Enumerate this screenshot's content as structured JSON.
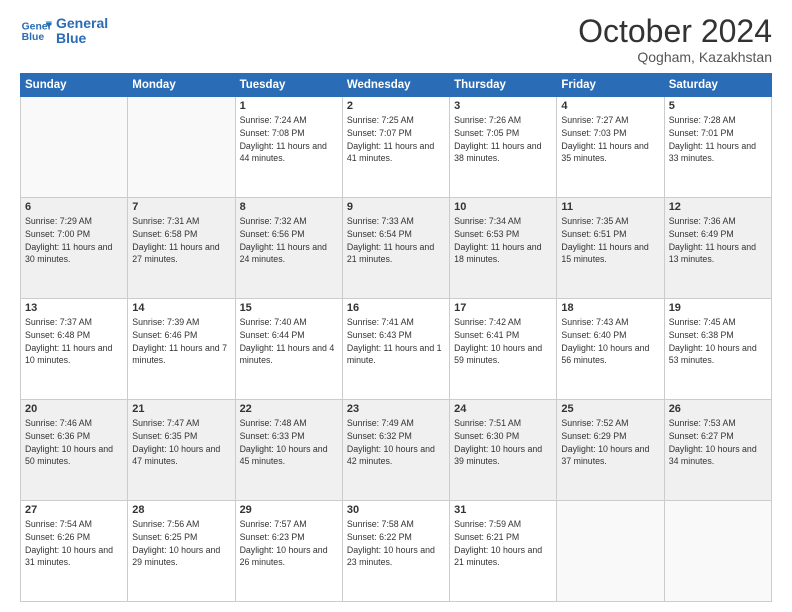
{
  "header": {
    "logo_line1": "General",
    "logo_line2": "Blue",
    "month": "October 2024",
    "location": "Qogham, Kazakhstan"
  },
  "weekdays": [
    "Sunday",
    "Monday",
    "Tuesday",
    "Wednesday",
    "Thursday",
    "Friday",
    "Saturday"
  ],
  "weeks": [
    [
      {
        "day": "",
        "info": ""
      },
      {
        "day": "",
        "info": ""
      },
      {
        "day": "1",
        "info": "Sunrise: 7:24 AM\nSunset: 7:08 PM\nDaylight: 11 hours and 44 minutes."
      },
      {
        "day": "2",
        "info": "Sunrise: 7:25 AM\nSunset: 7:07 PM\nDaylight: 11 hours and 41 minutes."
      },
      {
        "day": "3",
        "info": "Sunrise: 7:26 AM\nSunset: 7:05 PM\nDaylight: 11 hours and 38 minutes."
      },
      {
        "day": "4",
        "info": "Sunrise: 7:27 AM\nSunset: 7:03 PM\nDaylight: 11 hours and 35 minutes."
      },
      {
        "day": "5",
        "info": "Sunrise: 7:28 AM\nSunset: 7:01 PM\nDaylight: 11 hours and 33 minutes."
      }
    ],
    [
      {
        "day": "6",
        "info": "Sunrise: 7:29 AM\nSunset: 7:00 PM\nDaylight: 11 hours and 30 minutes."
      },
      {
        "day": "7",
        "info": "Sunrise: 7:31 AM\nSunset: 6:58 PM\nDaylight: 11 hours and 27 minutes."
      },
      {
        "day": "8",
        "info": "Sunrise: 7:32 AM\nSunset: 6:56 PM\nDaylight: 11 hours and 24 minutes."
      },
      {
        "day": "9",
        "info": "Sunrise: 7:33 AM\nSunset: 6:54 PM\nDaylight: 11 hours and 21 minutes."
      },
      {
        "day": "10",
        "info": "Sunrise: 7:34 AM\nSunset: 6:53 PM\nDaylight: 11 hours and 18 minutes."
      },
      {
        "day": "11",
        "info": "Sunrise: 7:35 AM\nSunset: 6:51 PM\nDaylight: 11 hours and 15 minutes."
      },
      {
        "day": "12",
        "info": "Sunrise: 7:36 AM\nSunset: 6:49 PM\nDaylight: 11 hours and 13 minutes."
      }
    ],
    [
      {
        "day": "13",
        "info": "Sunrise: 7:37 AM\nSunset: 6:48 PM\nDaylight: 11 hours and 10 minutes."
      },
      {
        "day": "14",
        "info": "Sunrise: 7:39 AM\nSunset: 6:46 PM\nDaylight: 11 hours and 7 minutes."
      },
      {
        "day": "15",
        "info": "Sunrise: 7:40 AM\nSunset: 6:44 PM\nDaylight: 11 hours and 4 minutes."
      },
      {
        "day": "16",
        "info": "Sunrise: 7:41 AM\nSunset: 6:43 PM\nDaylight: 11 hours and 1 minute."
      },
      {
        "day": "17",
        "info": "Sunrise: 7:42 AM\nSunset: 6:41 PM\nDaylight: 10 hours and 59 minutes."
      },
      {
        "day": "18",
        "info": "Sunrise: 7:43 AM\nSunset: 6:40 PM\nDaylight: 10 hours and 56 minutes."
      },
      {
        "day": "19",
        "info": "Sunrise: 7:45 AM\nSunset: 6:38 PM\nDaylight: 10 hours and 53 minutes."
      }
    ],
    [
      {
        "day": "20",
        "info": "Sunrise: 7:46 AM\nSunset: 6:36 PM\nDaylight: 10 hours and 50 minutes."
      },
      {
        "day": "21",
        "info": "Sunrise: 7:47 AM\nSunset: 6:35 PM\nDaylight: 10 hours and 47 minutes."
      },
      {
        "day": "22",
        "info": "Sunrise: 7:48 AM\nSunset: 6:33 PM\nDaylight: 10 hours and 45 minutes."
      },
      {
        "day": "23",
        "info": "Sunrise: 7:49 AM\nSunset: 6:32 PM\nDaylight: 10 hours and 42 minutes."
      },
      {
        "day": "24",
        "info": "Sunrise: 7:51 AM\nSunset: 6:30 PM\nDaylight: 10 hours and 39 minutes."
      },
      {
        "day": "25",
        "info": "Sunrise: 7:52 AM\nSunset: 6:29 PM\nDaylight: 10 hours and 37 minutes."
      },
      {
        "day": "26",
        "info": "Sunrise: 7:53 AM\nSunset: 6:27 PM\nDaylight: 10 hours and 34 minutes."
      }
    ],
    [
      {
        "day": "27",
        "info": "Sunrise: 7:54 AM\nSunset: 6:26 PM\nDaylight: 10 hours and 31 minutes."
      },
      {
        "day": "28",
        "info": "Sunrise: 7:56 AM\nSunset: 6:25 PM\nDaylight: 10 hours and 29 minutes."
      },
      {
        "day": "29",
        "info": "Sunrise: 7:57 AM\nSunset: 6:23 PM\nDaylight: 10 hours and 26 minutes."
      },
      {
        "day": "30",
        "info": "Sunrise: 7:58 AM\nSunset: 6:22 PM\nDaylight: 10 hours and 23 minutes."
      },
      {
        "day": "31",
        "info": "Sunrise: 7:59 AM\nSunset: 6:21 PM\nDaylight: 10 hours and 21 minutes."
      },
      {
        "day": "",
        "info": ""
      },
      {
        "day": "",
        "info": ""
      }
    ]
  ]
}
